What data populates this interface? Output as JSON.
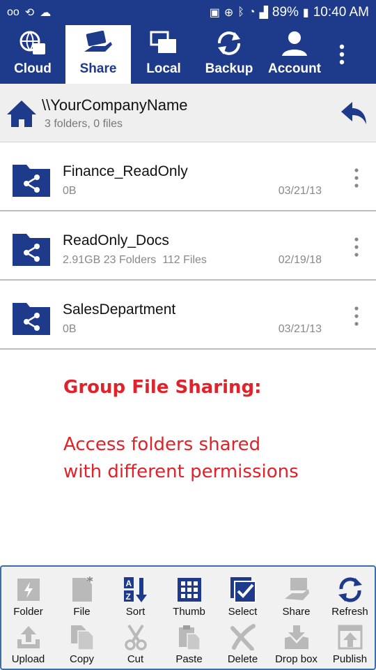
{
  "statusbar": {
    "battery": "89%",
    "time": "10:40 AM"
  },
  "tabs": [
    {
      "label": "Cloud",
      "icon": "cloud-globe-icon"
    },
    {
      "label": "Share",
      "icon": "share-hand-icon",
      "active": true
    },
    {
      "label": "Local",
      "icon": "local-windows-icon"
    },
    {
      "label": "Backup",
      "icon": "backup-sync-icon"
    },
    {
      "label": "Account",
      "icon": "account-person-icon"
    }
  ],
  "path": {
    "title": "\\\\YourCompanyName",
    "summary": "3 folders, 0 files"
  },
  "files": [
    {
      "name": "Finance_ReadOnly",
      "meta": "0B",
      "date": "03/21/13"
    },
    {
      "name": "ReadOnly_Docs",
      "meta": "2.91GB 23 Folders  112 Files",
      "date": "02/19/18"
    },
    {
      "name": "SalesDepartment",
      "meta": "0B",
      "date": "03/21/13"
    }
  ],
  "promo": {
    "heading": "Group File Sharing:",
    "line1": "Access folders shared",
    "line2": "with different permissions"
  },
  "toolbar": {
    "row1": [
      {
        "label": "Folder",
        "icon": "new-folder-icon",
        "enabled": false
      },
      {
        "label": "File",
        "icon": "new-file-icon",
        "enabled": false
      },
      {
        "label": "Sort",
        "icon": "sort-az-icon",
        "enabled": true
      },
      {
        "label": "Thumb",
        "icon": "thumbnail-grid-icon",
        "enabled": true
      },
      {
        "label": "Select",
        "icon": "select-check-icon",
        "enabled": true
      },
      {
        "label": "Share",
        "icon": "share-icon",
        "enabled": false
      },
      {
        "label": "Refresh",
        "icon": "refresh-icon",
        "enabled": true
      }
    ],
    "row2": [
      {
        "label": "Upload",
        "icon": "upload-icon",
        "enabled": false
      },
      {
        "label": "Copy",
        "icon": "copy-icon",
        "enabled": false
      },
      {
        "label": "Cut",
        "icon": "cut-scissors-icon",
        "enabled": false
      },
      {
        "label": "Paste",
        "icon": "paste-icon",
        "enabled": false
      },
      {
        "label": "Delete",
        "icon": "delete-x-icon",
        "enabled": false
      },
      {
        "label": "Drop box",
        "icon": "dropbox-icon",
        "enabled": false
      },
      {
        "label": "Publish",
        "icon": "publish-icon",
        "enabled": false
      }
    ]
  },
  "colors": {
    "brand": "#1e3a8a",
    "promo": "#e0222b",
    "disabled_icon": "#b9b9b9"
  }
}
